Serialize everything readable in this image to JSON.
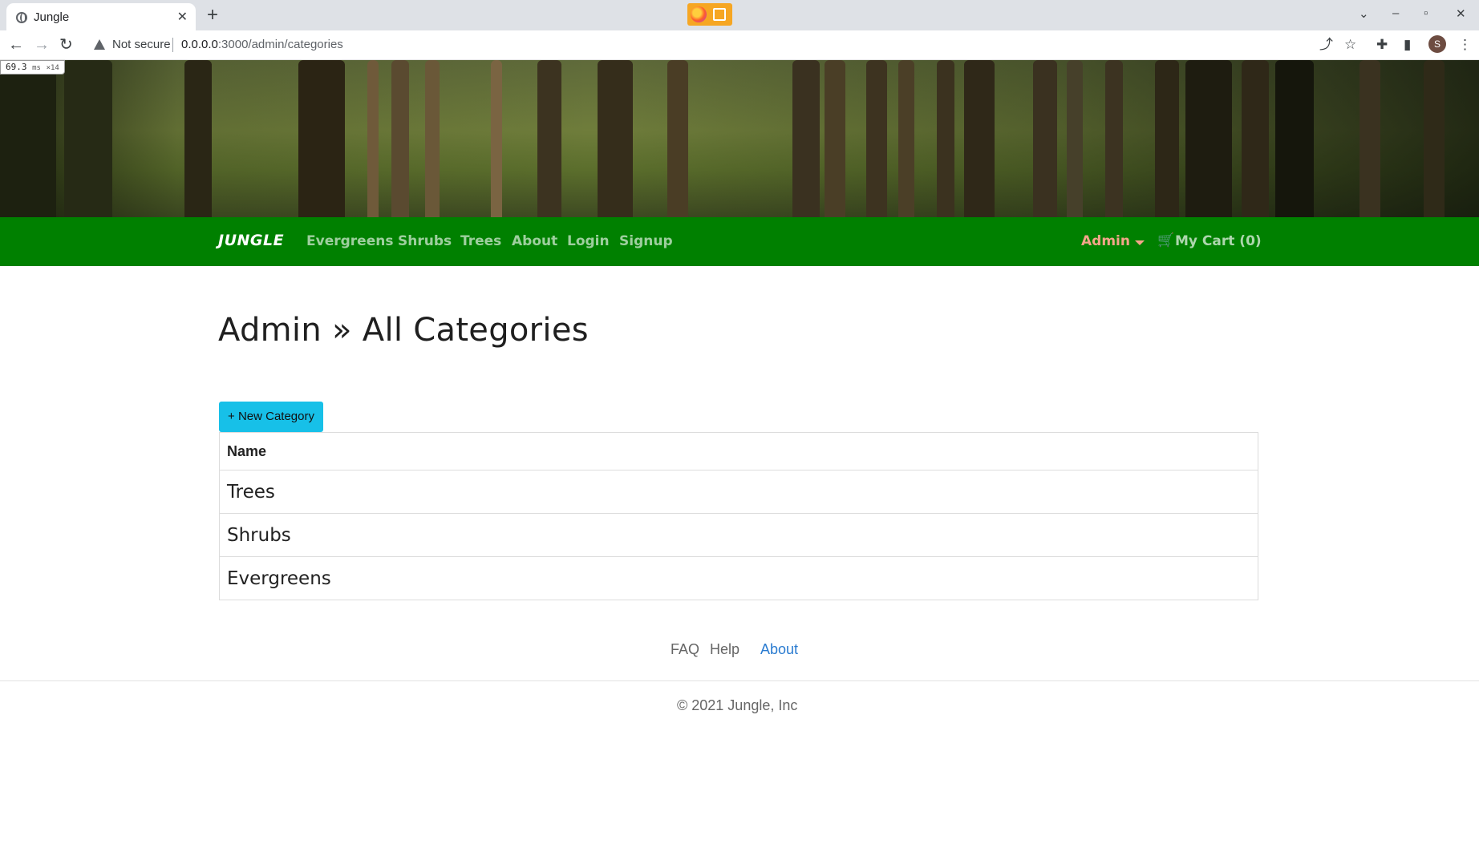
{
  "browser": {
    "tab_title": "Jungle",
    "new_tab": "+",
    "tab_close": "✕",
    "security_label": "Not secure",
    "url_host": "0.0.0.0",
    "url_path": ":3000/admin/categories",
    "profile_initial": "S",
    "perf_value": "69.3",
    "perf_unit": "ms",
    "perf_count": "×14"
  },
  "navbar": {
    "brand": "JUNGLE",
    "links": [
      "Evergreens",
      "Shrubs",
      "Trees",
      "About",
      "Login",
      "Signup"
    ],
    "admin_label": "Admin",
    "cart_label": "My Cart (0)",
    "colors": {
      "bar": "#008000",
      "admin": "#f4a58a"
    }
  },
  "page": {
    "title": "Admin » All Categories",
    "new_button": "+ New Category",
    "table": {
      "header": "Name",
      "rows": [
        "Trees",
        "Shrubs",
        "Evergreens"
      ]
    }
  },
  "footer": {
    "links": [
      "FAQ",
      "Help",
      "About"
    ],
    "copyright": "© 2021 Jungle, Inc"
  },
  "icons": {
    "back": "←",
    "forward": "→",
    "reload": "↻",
    "share": "⤴",
    "bookmark": "☆",
    "extensions": "✚",
    "sidepanel": "▮",
    "menu": "⋮",
    "cart": "🛒",
    "tab_list": "⌄",
    "minimize": "–",
    "restore": "▫",
    "close": "✕"
  }
}
